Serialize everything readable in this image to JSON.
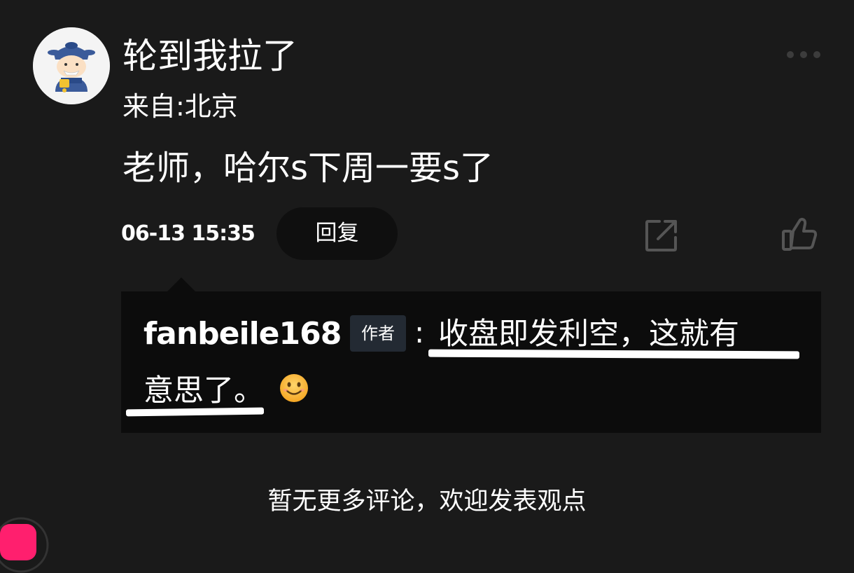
{
  "comment": {
    "username": "轮到我拉了",
    "location": "来自:北京",
    "text": "老师，哈尔s下周一要s了",
    "timestamp": "06-13 15:35",
    "reply_label": "回复",
    "icons": {
      "more": "more-icon",
      "share": "share-icon",
      "like": "like-icon",
      "avatar": "cartoon-avatar"
    }
  },
  "reply": {
    "author": "fanbeile168",
    "badge": "作者",
    "colon": ":",
    "text_line1": "收盘即发利空，这就有",
    "text_line2": "意思了。",
    "emoji": "smile-emoji"
  },
  "footer": {
    "message": "暂无更多评论，欢迎发表观点"
  },
  "colors": {
    "background": "#1a1a1a",
    "reply_background": "#0c0c0c",
    "text": "#ffffff",
    "badge_background": "#232a33",
    "accent_pink": "#ff1f6e"
  }
}
